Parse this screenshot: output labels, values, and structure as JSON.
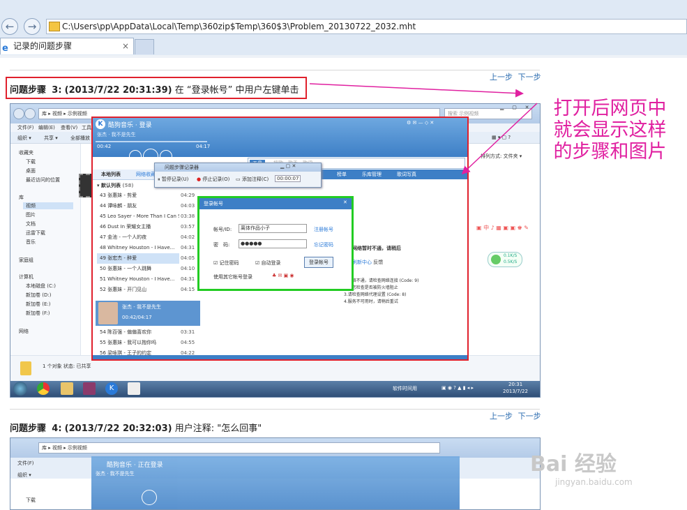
{
  "browser": {
    "address": "C:\\Users\\pp\\AppData\\Local\\Temp\\360zip$Temp\\360$3\\Problem_20130722_2032.mht",
    "tab_title": "记录的问题步骤",
    "tab_close": "×"
  },
  "nav": {
    "prev": "上一步",
    "next": "下一步"
  },
  "step3": {
    "label": "问题步骤",
    "num": "3:",
    "time": "(2013/7/22 20:31:39)",
    "desc": "在 “登录帐号” 中用户左键单击"
  },
  "step4": {
    "label": "问题步骤",
    "num": "4:",
    "time": "(2013/7/22 20:32:03)",
    "desc": "用户注释: \"怎么回事\""
  },
  "annotation": {
    "lines": [
      "打开后网页中",
      "就会显示这样",
      "的步骤和图片"
    ],
    "color": "#e020a0"
  },
  "explorer": {
    "crumb": "库 ▸ 视频 ▸ 示例视频",
    "search": "搜索 示例视频",
    "menus": [
      "文件(F)",
      "编辑(E)",
      "查看(V)",
      "工具(T)"
    ],
    "toolbar": [
      "组织 ▾",
      "共享 ▾",
      "全部播放"
    ],
    "sidebar": [
      "收藏夹",
      "下载",
      "桌面",
      "最近访问的位置",
      "库",
      "视频",
      "图片",
      "文档",
      "迅雷下载",
      "音乐",
      "家庭组",
      "计算机",
      "本地磁盘 (C:)",
      "新加卷 (D:)",
      "新加卷 (E:)",
      "新加卷 (F:)",
      "网络"
    ],
    "status": "1 个对象  状态: 已共享",
    "arrange": "排列方式:  文件夹 ▾"
  },
  "kugou": {
    "title": "酷狗音乐 · 登录",
    "now_playing": "张杰 · 我不是先生",
    "elapsed": "00:42",
    "total": "04:17",
    "tabs": [
      "本地列表",
      "网络收藏"
    ],
    "list_header": "默认列表",
    "list_count": "(58)",
    "songs": [
      {
        "n": "43 张惠妹 - 剪爱",
        "t": "04:29"
      },
      {
        "n": "44 谭咏麟 - 朋友",
        "t": "04:03"
      },
      {
        "n": "45 Leo Sayer - More Than I Can Say",
        "t": "03:38"
      },
      {
        "n": "46 Dust In 荣耀女主播",
        "t": "03:57"
      },
      {
        "n": "47 金池 - 一个人的夜",
        "t": "04:02"
      },
      {
        "n": "48 Whitney Houston - I Have...",
        "t": "04:31"
      },
      {
        "n": "49 张宏杰 - 醉爱",
        "t": "04:05"
      },
      {
        "n": "50 张惠妹 - 一个人跳舞",
        "t": "04:10"
      },
      {
        "n": "51 Whitney Houston - I Have...",
        "t": "04:31"
      },
      {
        "n": "52 张惠妹 - 开门见山",
        "t": "04:15"
      }
    ],
    "playing_title": "张杰 - 我不是先生",
    "playing_time": "00:42/04:17",
    "songs2": [
      {
        "n": "54 陈百强 - 偏偏喜欢你",
        "t": "03:31"
      },
      {
        "n": "55 张惠妹 - 我可以抱你吗",
        "t": "04:55"
      },
      {
        "n": "56 梁咏琪 - 王子的约定",
        "t": "04:22"
      }
    ],
    "nav_tabs": [
      "榜单",
      "乐库管理",
      "歌词写真"
    ],
    "help_lines": [
      "网络暂时不通，请稍后",
      "1.网络不通，请检查网络连接 (Code: 9)",
      "2.请您检查是否被防火墙阻止",
      "3.请检查网络代理设置 (Code: 8)",
      "4.服务不可用时，请稍后重试"
    ],
    "help_link": "刷新中心",
    "help_retry": "反馈",
    "search_tab": "工具",
    "search_placeholder": "搜歌、歌手、歌词"
  },
  "recorder": {
    "title": "问题步骤记录器",
    "pause": "暂停记录(U)",
    "stop": "停止记录(O)",
    "comment": "添加注释(C)",
    "time": "00:00:07"
  },
  "login": {
    "title": "登录帐号",
    "account_label": "帐号/ID:",
    "account_value": "离体作品小子",
    "register": "注册帐号",
    "pwd_label": "密　码:",
    "pwd_value": "●●●●●",
    "forgot": "忘记密码",
    "remember": "记住密码",
    "autologin": "自动登录",
    "login_btn": "登录帐号",
    "other": "使用其它帐号登录"
  },
  "taskbar": {
    "clock_time": "20:31",
    "clock_date": "2013/7/22",
    "tray_text": "软件时间用"
  },
  "side360": {
    "up": "0.1K/S",
    "down": "0.5K/S"
  },
  "watermark": {
    "brand": "Bai 经验",
    "url": "jingyan.baidu.com"
  },
  "kugou2": {
    "title": "酷狗音乐 · 正在登录",
    "now_playing": "张杰 · 我不是先生"
  }
}
